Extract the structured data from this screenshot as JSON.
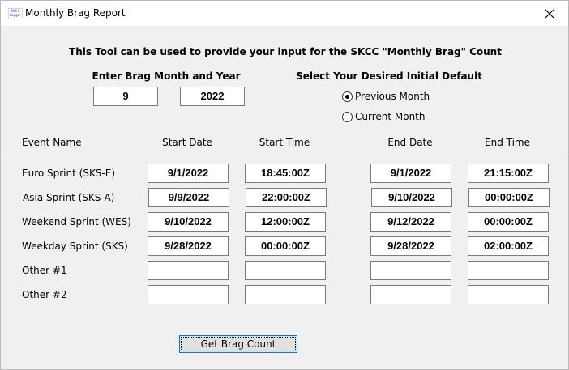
{
  "window": {
    "title": "Monthly Brag Report",
    "icon_label": "SKCC Logger"
  },
  "header": {
    "description": "This Tool can be used to provide your input for the  SKCC \"Monthly Brag\" Count",
    "month_year_label": "Enter Brag Month and Year",
    "month_value": "9",
    "year_value": "2022",
    "default_label": "Select Your Desired Initial Default",
    "options": [
      {
        "label": "Previous Month",
        "selected": true
      },
      {
        "label": "Current Month",
        "selected": false
      }
    ]
  },
  "columns": {
    "event_name": "Event Name",
    "start_date": "Start Date",
    "start_time": "Start Time",
    "end_date": "End Date",
    "end_time": "End Time"
  },
  "rows": [
    {
      "name": "Euro Sprint (SKS-E)",
      "start_date": "9/1/2022",
      "start_time": "18:45:00Z",
      "end_date": "9/1/2022",
      "end_time": "21:15:00Z"
    },
    {
      "name": "Asia Sprint (SKS-A)",
      "start_date": "9/9/2022",
      "start_time": "22:00:00Z",
      "end_date": "9/10/2022",
      "end_time": "00:00:00Z"
    },
    {
      "name": "Weekend Sprint (WES)",
      "start_date": "9/10/2022",
      "start_time": "12:00:00Z",
      "end_date": "9/12/2022",
      "end_time": "00:00:00Z"
    },
    {
      "name": "Weekday Sprint (SKS)",
      "start_date": "9/28/2022",
      "start_time": "00:00:00Z",
      "end_date": "9/28/2022",
      "end_time": "02:00:00Z"
    },
    {
      "name": "Other #1",
      "start_date": "",
      "start_time": "",
      "end_date": "",
      "end_time": ""
    },
    {
      "name": "Other #2",
      "start_date": "",
      "start_time": "",
      "end_date": "",
      "end_time": ""
    }
  ],
  "button": {
    "label": "Get Brag Count"
  }
}
